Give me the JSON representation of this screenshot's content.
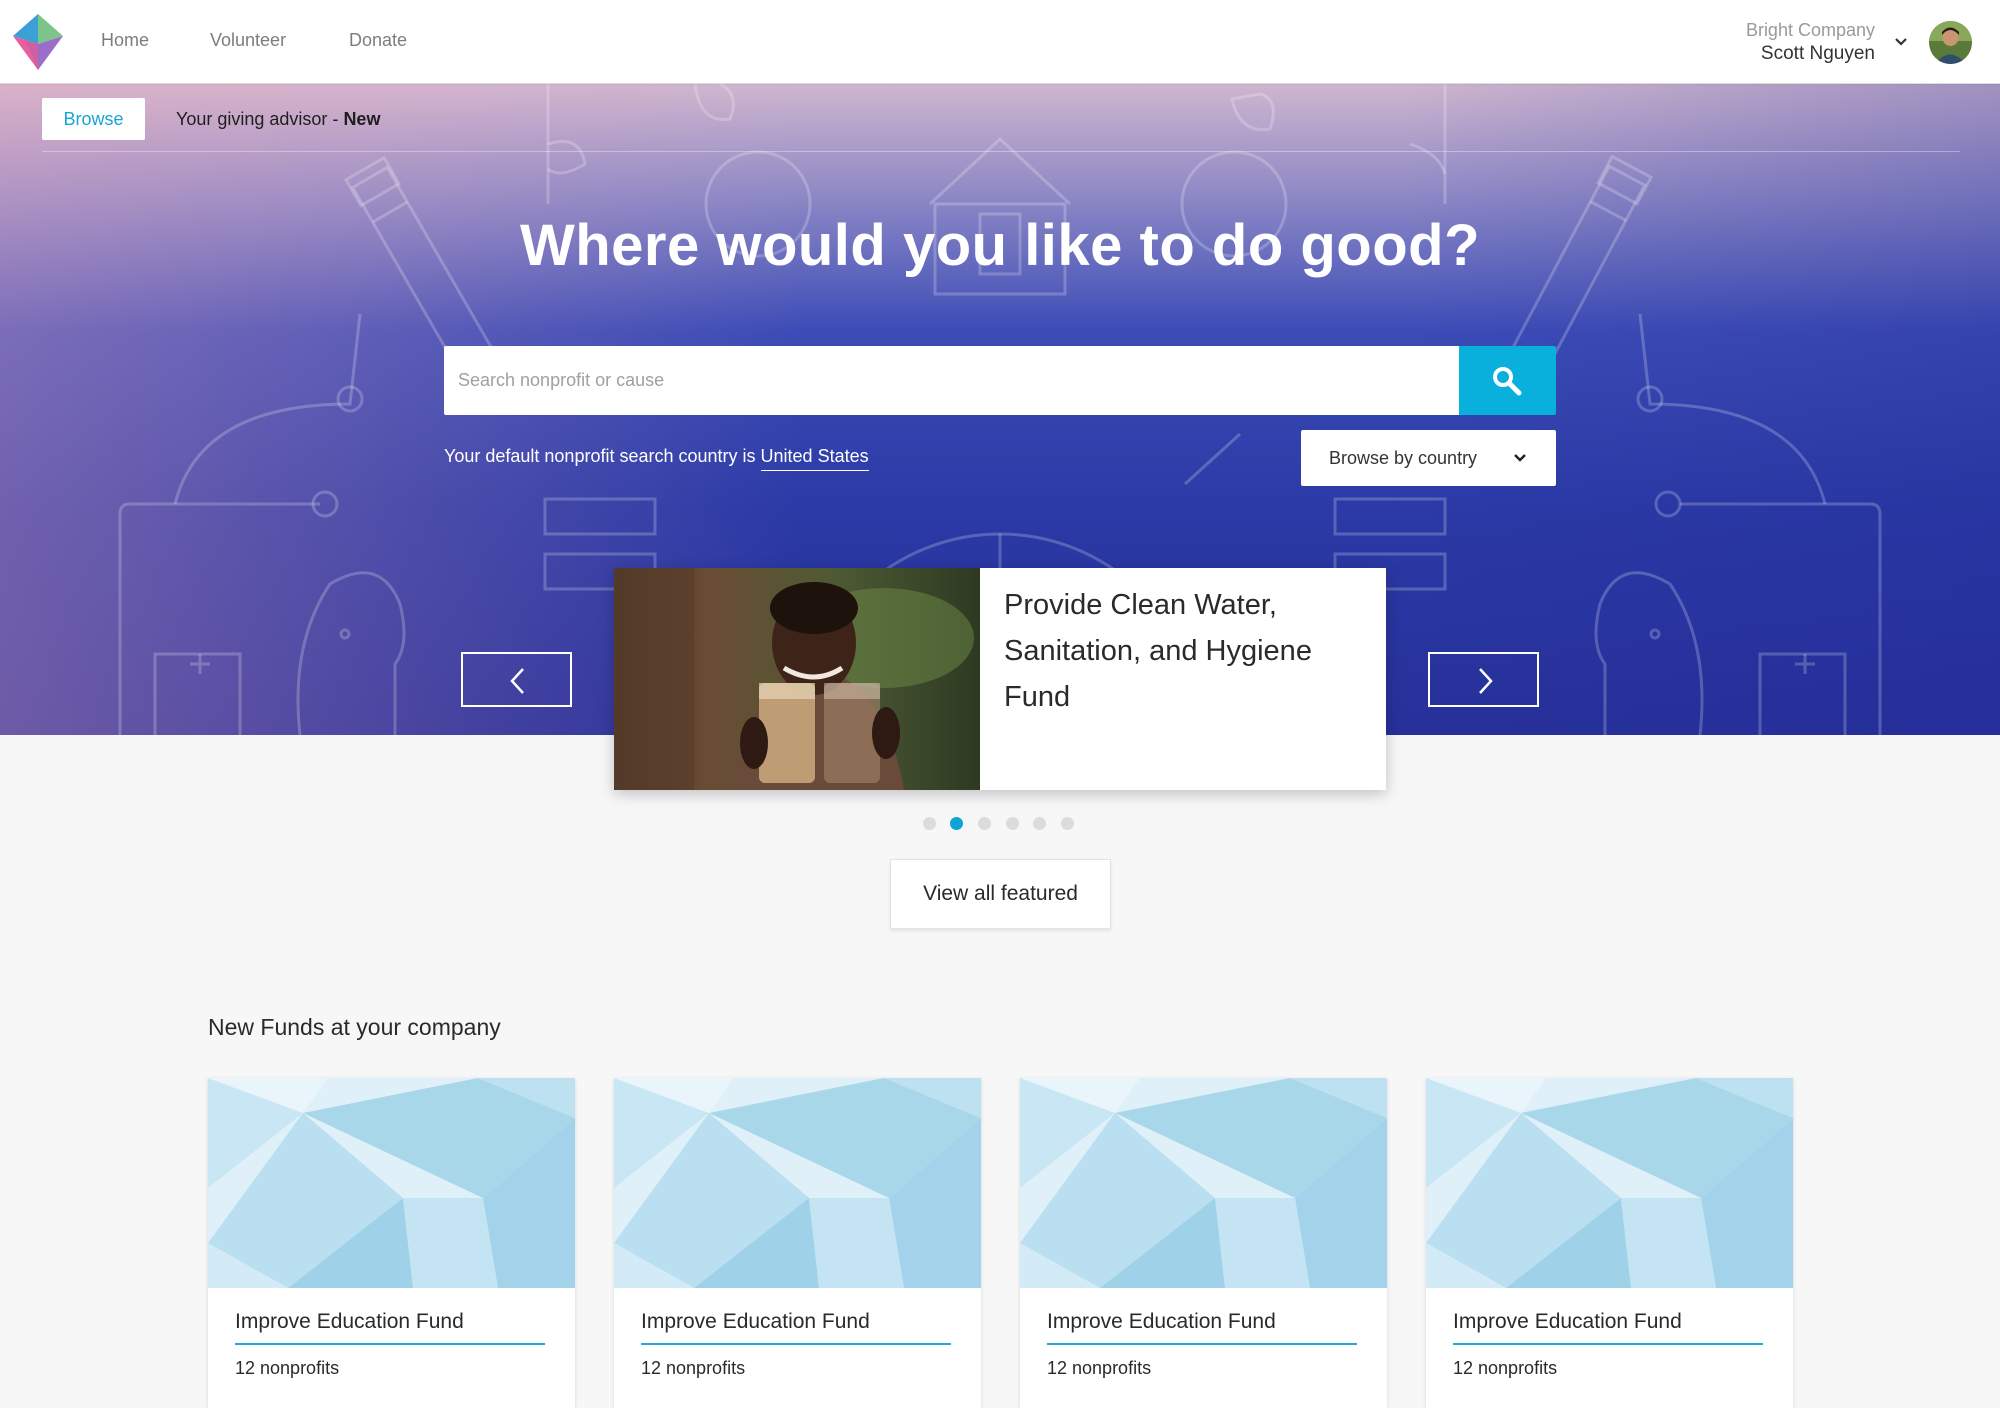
{
  "nav": {
    "links": [
      "Home",
      "Volunteer",
      "Donate"
    ],
    "company": "Bright Company",
    "user": "Scott Nguyen",
    "avatar_icon": "user-avatar",
    "logo_icon": "app-logo"
  },
  "subnav": {
    "browse": "Browse",
    "advisor": "Your giving advisor - ",
    "advisor_badge": "New"
  },
  "hero": {
    "title": "Where would you like to do good?",
    "search_placeholder": "Search nonprofit or cause",
    "default_country_text": "Your default nonprofit search country is ",
    "default_country": "United States",
    "browse_country": "Browse by country"
  },
  "featured": {
    "title": "Provide Clean Water, Sanitation, and Hygiene Fund",
    "dot_count": 6,
    "active_dot": 2,
    "view_all": "View all featured"
  },
  "funds": {
    "section_title": "New Funds at your company",
    "items": [
      {
        "name": "Improve Education Fund",
        "count": "12 nonprofits"
      },
      {
        "name": "Improve Education Fund",
        "count": "12 nonprofits"
      },
      {
        "name": "Improve Education Fund",
        "count": "12 nonprofits"
      },
      {
        "name": "Improve Education Fund",
        "count": "12 nonprofits"
      }
    ]
  },
  "colors": {
    "accent": "#0ab0dc",
    "hero_top": "#cfb6cf",
    "hero_bottom": "#27309a",
    "fund_pattern": "#a9d7ea"
  }
}
